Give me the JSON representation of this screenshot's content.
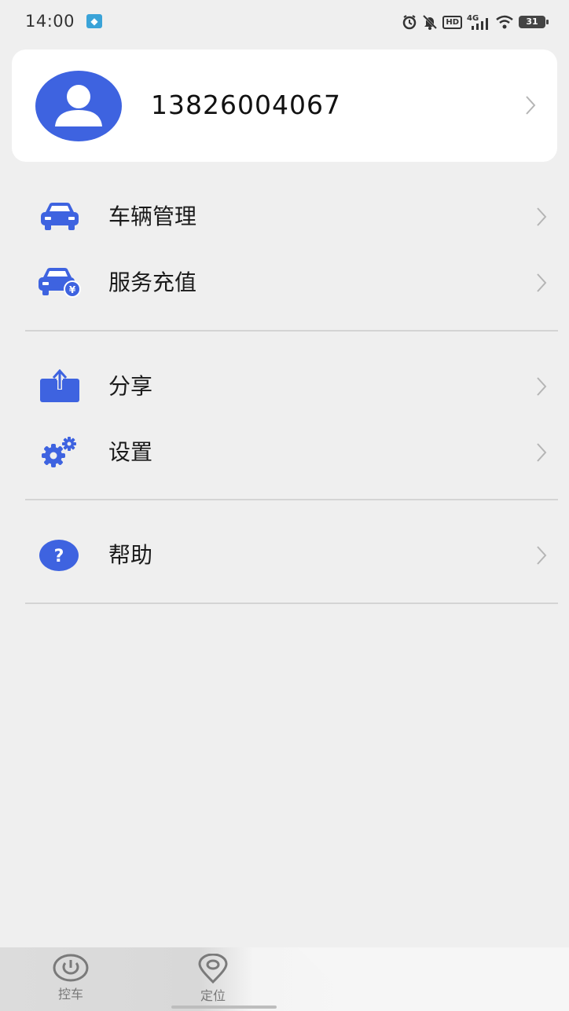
{
  "status_bar": {
    "time": "14:00",
    "network": "4G",
    "hd": "HD",
    "battery": "31",
    "icons": [
      "app-notification-icon",
      "alarm-icon",
      "mute-icon",
      "hd-icon",
      "signal-icon",
      "wifi-icon",
      "battery-icon"
    ]
  },
  "profile": {
    "phone": "13826004067",
    "avatar_icon": "user-avatar-icon",
    "accent": "#3e63e0"
  },
  "menu": {
    "groups": [
      [
        {
          "label": "车辆管理",
          "icon": "car-icon"
        },
        {
          "label": "服务充值",
          "icon": "car-payment-icon"
        }
      ],
      [
        {
          "label": "分享",
          "icon": "share-icon"
        },
        {
          "label": "设置",
          "icon": "gear-icon"
        }
      ],
      [
        {
          "label": "帮助",
          "icon": "help-icon"
        }
      ]
    ]
  },
  "bottom_nav": {
    "items": [
      {
        "label": "控车",
        "icon": "power-icon"
      },
      {
        "label": "定位",
        "icon": "location-pin-icon"
      }
    ]
  },
  "colors": {
    "accent": "#3e63e0",
    "background": "#efefef",
    "card": "#ffffff",
    "divider": "#d4d4d4",
    "chevron": "#b5b5b5"
  }
}
